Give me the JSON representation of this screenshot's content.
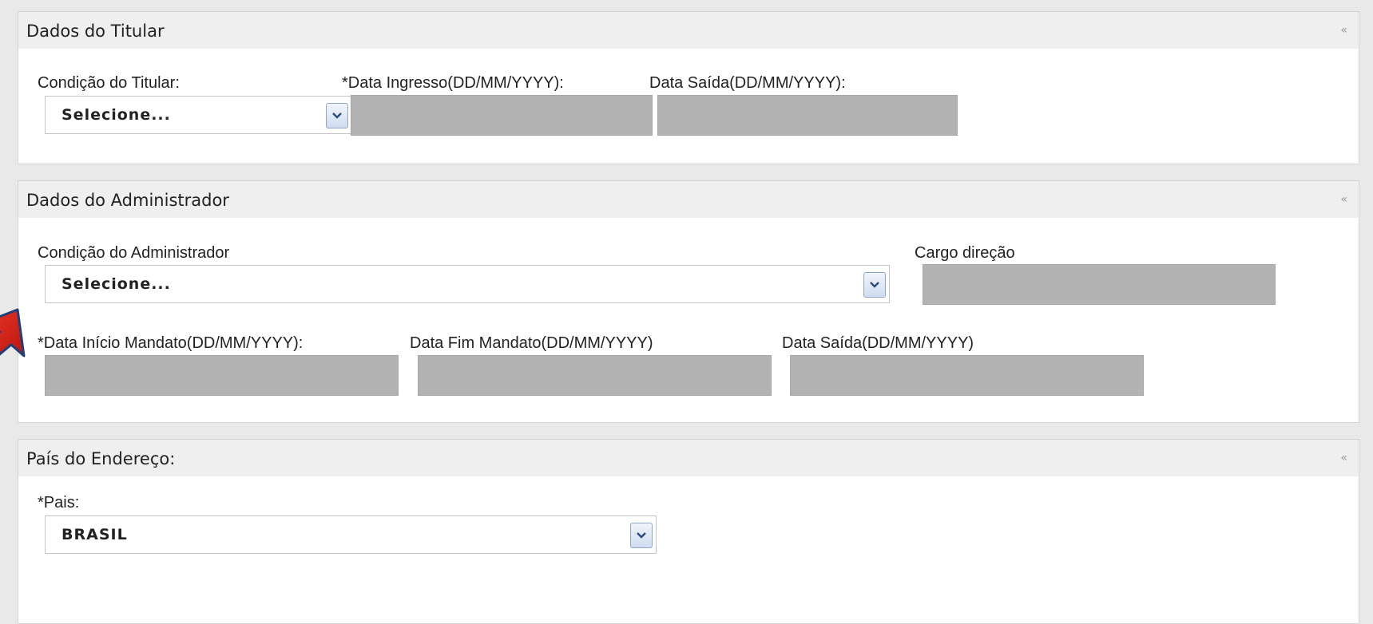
{
  "titular": {
    "title": "Dados do Titular",
    "collapse_icon": "«",
    "condicao_label": "Condição do Titular:",
    "condicao_value": "Selecione...",
    "data_ingresso_label": "*Data Ingresso(DD/MM/YYYY):",
    "data_ingresso_value": "",
    "data_saida_label": "Data Saída(DD/MM/YYYY):",
    "data_saida_value": ""
  },
  "administrador": {
    "title": "Dados do Administrador",
    "collapse_icon": "«",
    "condicao_label": "Condição do Administrador",
    "condicao_value": "Selecione...",
    "cargo_label": "Cargo direção",
    "cargo_value": "",
    "inicio_label": "*Data Início Mandato(DD/MM/YYYY):",
    "inicio_value": "",
    "fim_label": "Data Fim Mandato(DD/MM/YYYY)",
    "fim_value": "",
    "saida_label": "Data Saída(DD/MM/YYYY)",
    "saida_value": ""
  },
  "endereco": {
    "title": "País do Endereço:",
    "collapse_icon": "«",
    "pais_label": "*Pais:",
    "pais_value": "BRASIL"
  },
  "colors": {
    "disabled_field": "#b3b3b3",
    "panel_header": "#efefef",
    "arrow": "#d9261c"
  }
}
